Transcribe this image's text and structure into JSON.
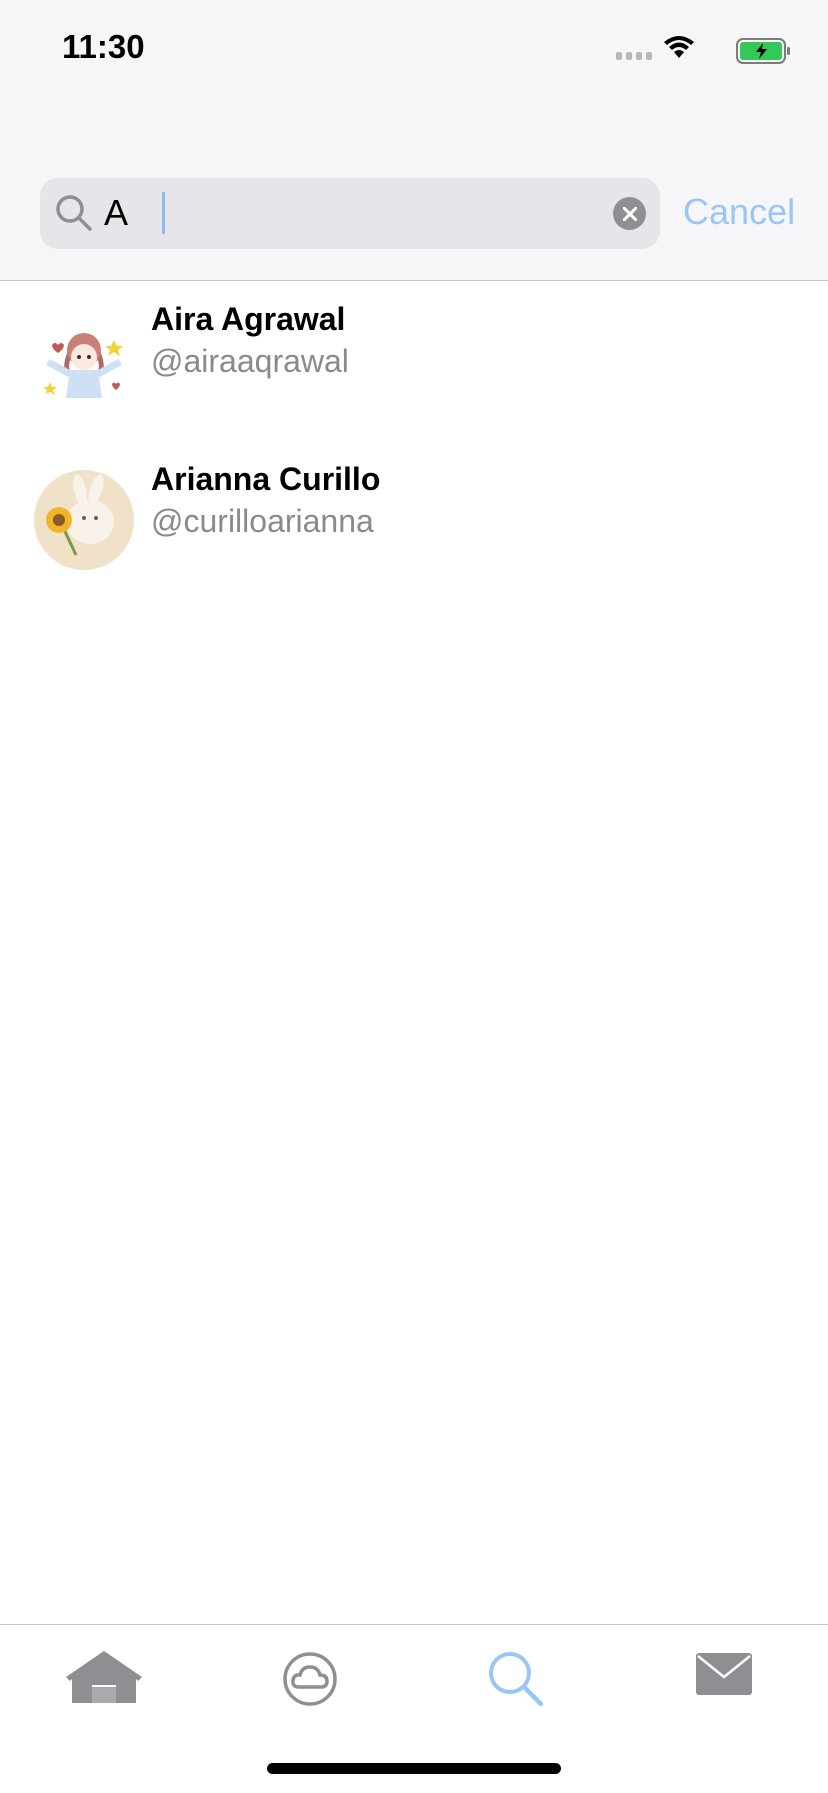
{
  "status_bar": {
    "time": "11:30"
  },
  "search": {
    "query": "A",
    "cancel_label": "Cancel"
  },
  "results": [
    {
      "name": "Aira Agrawal",
      "handle": "@airaaqrawal"
    },
    {
      "name": "Arianna Curillo",
      "handle": "@curilloarianna"
    }
  ],
  "tab_bar": {
    "tabs": [
      {
        "icon": "home-icon",
        "active": false
      },
      {
        "icon": "cloud-icon",
        "active": false
      },
      {
        "icon": "search-icon",
        "active": true
      },
      {
        "icon": "mail-icon",
        "active": false
      }
    ]
  },
  "colors": {
    "accent": "#99c7f5",
    "inactive_icon": "#8e8e93",
    "header_bg": "#f6f6f8"
  }
}
